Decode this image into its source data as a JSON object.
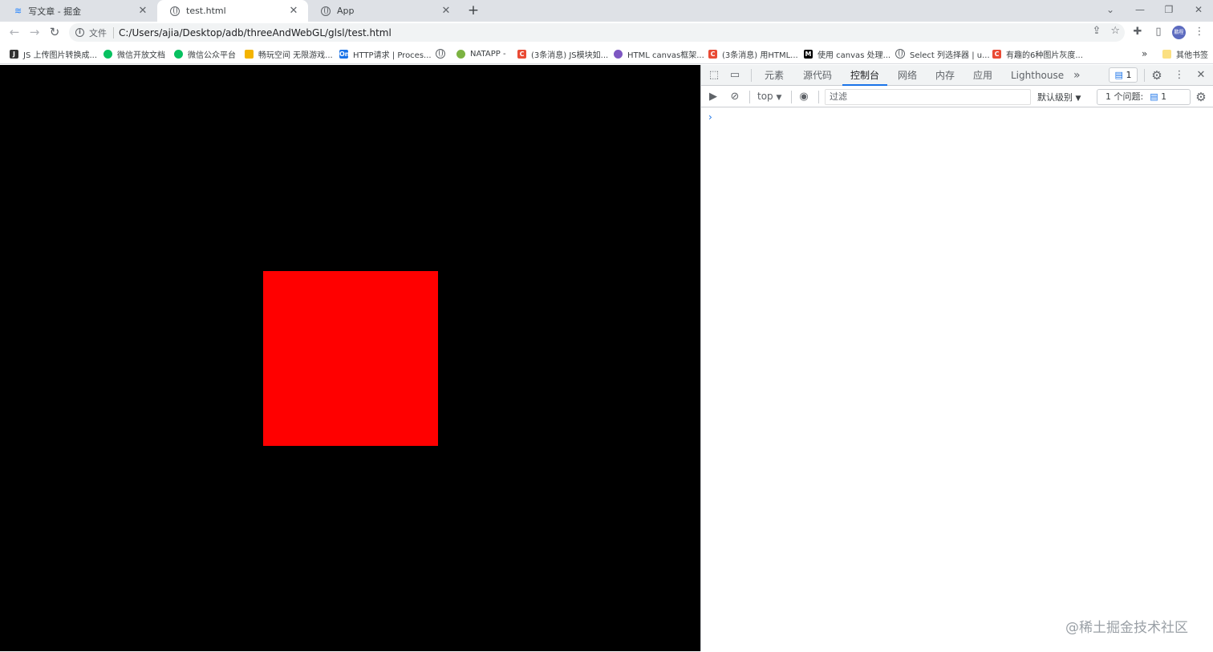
{
  "tabs": [
    {
      "title": "写文章 - 掘金",
      "icon": "juejin-icon",
      "active": false
    },
    {
      "title": "test.html",
      "icon": "globe-icon",
      "active": true
    },
    {
      "title": "App",
      "icon": "globe-icon",
      "active": false
    }
  ],
  "toolbar": {
    "file_chip": "文件",
    "url": "C:/Users/ajia/Desktop/adb/threeAndWebGL/glsl/test.html",
    "avatar_text": "鹏程"
  },
  "bookmarks": [
    {
      "label": "JS 上传图片转换成...",
      "color": "#333333"
    },
    {
      "label": "微信开放文档",
      "color": "#07c160"
    },
    {
      "label": "微信公众平台",
      "color": "#07c160"
    },
    {
      "label": "畅玩空间 无限游戏...",
      "color": "#f4b400"
    },
    {
      "label": "HTTP请求 | Proces...",
      "color": "#1a73e8"
    },
    {
      "label": "",
      "color": "#5f6368"
    },
    {
      "label": "NATAPP -",
      "color": "#7cb342"
    },
    {
      "label": "(3条消息) JS模块如...",
      "color": "#e94b35"
    },
    {
      "label": "HTML canvas框架...",
      "color": "#7e57c2"
    },
    {
      "label": "(3条消息) 用HTML...",
      "color": "#e94b35"
    },
    {
      "label": "使用 canvas 处理...",
      "color": "#000000"
    },
    {
      "label": "Select 列选择器 | u...",
      "color": "#5f6368"
    },
    {
      "label": "有趣的6种图片灰度...",
      "color": "#e94b35"
    }
  ],
  "bookmarks_overflow": "»",
  "other_bookmarks": "其他书签",
  "canvas": {
    "background": "#000000",
    "square_color": "#ff0000"
  },
  "devtools": {
    "tabs": [
      "元素",
      "源代码",
      "控制台",
      "网络",
      "内存",
      "应用",
      "Lighthouse"
    ],
    "active_tab": "控制台",
    "more_tabs": "»",
    "issues_count": "1",
    "context": "top",
    "filter_placeholder": "过滤",
    "levels": "默认级别",
    "issues_text": "1 个问题:",
    "issues_count2": "1",
    "prompt": "›"
  },
  "watermark": "@稀土掘金技术社区"
}
